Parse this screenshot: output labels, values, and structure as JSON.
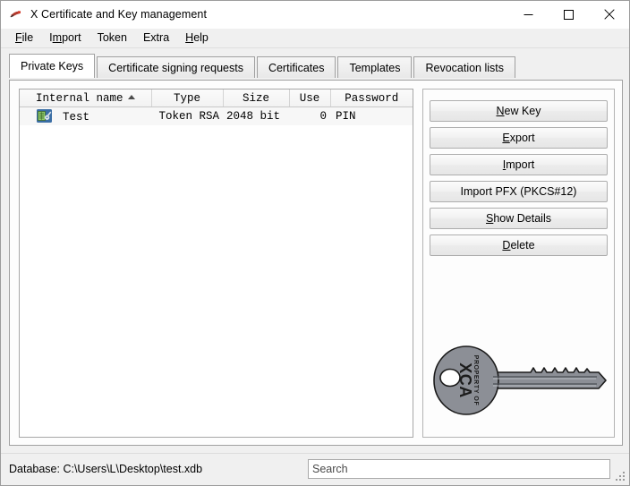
{
  "window": {
    "title": "X Certificate and Key management",
    "app_icon": "xca-app-icon",
    "minimize_label": "Minimize",
    "maximize_label": "Maximize",
    "close_label": "Close"
  },
  "menu": {
    "items": [
      {
        "label": "File",
        "accel_index": 0
      },
      {
        "label": "Import",
        "accel_index": 1
      },
      {
        "label": "Token",
        "accel_index": -1
      },
      {
        "label": "Extra",
        "accel_index": -1
      },
      {
        "label": "Help",
        "accel_index": 0
      }
    ]
  },
  "tabs": {
    "selected": "Private Keys",
    "items": [
      {
        "label": "Private Keys",
        "selected": true
      },
      {
        "label": "Certificate signing requests",
        "selected": false
      },
      {
        "label": "Certificates",
        "selected": false
      },
      {
        "label": "Templates",
        "selected": false
      },
      {
        "label": "Revocation lists",
        "selected": false
      }
    ]
  },
  "key_list": {
    "columns": [
      {
        "label": "Internal name",
        "sorted": "asc"
      },
      {
        "label": "Type",
        "sorted": ""
      },
      {
        "label": "Size",
        "sorted": ""
      },
      {
        "label": "Use",
        "sorted": ""
      },
      {
        "label": "Password",
        "sorted": ""
      }
    ],
    "sort_indicator": "triangle-up-icon",
    "rows": [
      {
        "icon": "token-key-icon",
        "internal_name": "Test",
        "type": "Token RSA",
        "size": "2048 bit",
        "use": "0",
        "password": "PIN"
      }
    ]
  },
  "buttons": [
    {
      "label": "New Key",
      "accel_index": 0,
      "name": "new-key-button"
    },
    {
      "label": "Export",
      "accel_index": 0,
      "name": "export-button"
    },
    {
      "label": "Import",
      "accel_index": 0,
      "name": "import-button"
    },
    {
      "label": "Import PFX (PKCS#12)",
      "accel_index": -1,
      "name": "import-pfx-button"
    },
    {
      "label": "Show Details",
      "accel_index": 0,
      "name": "show-details-button"
    },
    {
      "label": "Delete",
      "accel_index": 0,
      "name": "delete-button"
    }
  ],
  "key_graphic": {
    "name": "xca-key-illustration",
    "engraving_small": "PROPERTY OF",
    "engraving_large": "XCA",
    "body_color": "#8c8f96",
    "outline_color": "#1a1a1a"
  },
  "status_bar": {
    "database_label": "Database: C:\\Users\\L\\Desktop\\test.xdb",
    "search_placeholder": "Search",
    "search_value": ""
  },
  "colors": {
    "window_bg": "#f0f0f0",
    "panel_bg": "#fdfdfd",
    "list_bg": "#ffffff",
    "row_bg": "#f7f7f7",
    "border": "#a0a0a0",
    "icon_badge": "#3b6ea5",
    "icon_card": "#6fae4f"
  }
}
